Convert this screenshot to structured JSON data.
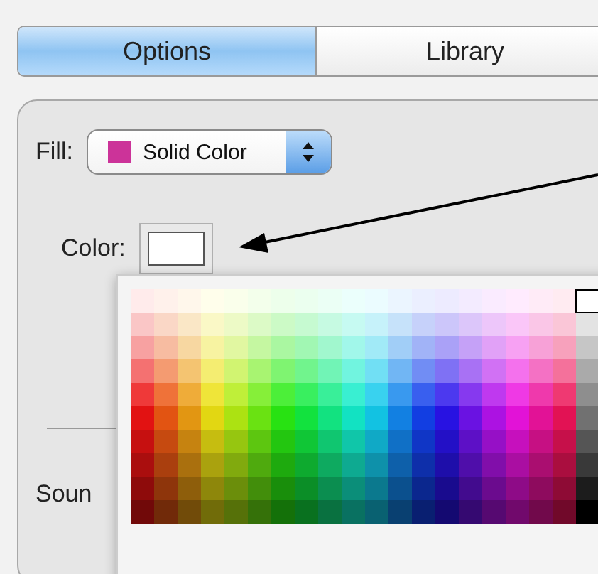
{
  "tabs": [
    {
      "label": "Options",
      "selected": true
    },
    {
      "label": "Library",
      "selected": false
    }
  ],
  "fill": {
    "label": "Fill:",
    "value": "Solid Color"
  },
  "color": {
    "label": "Color:"
  },
  "sound": {
    "label": "Soun"
  }
}
